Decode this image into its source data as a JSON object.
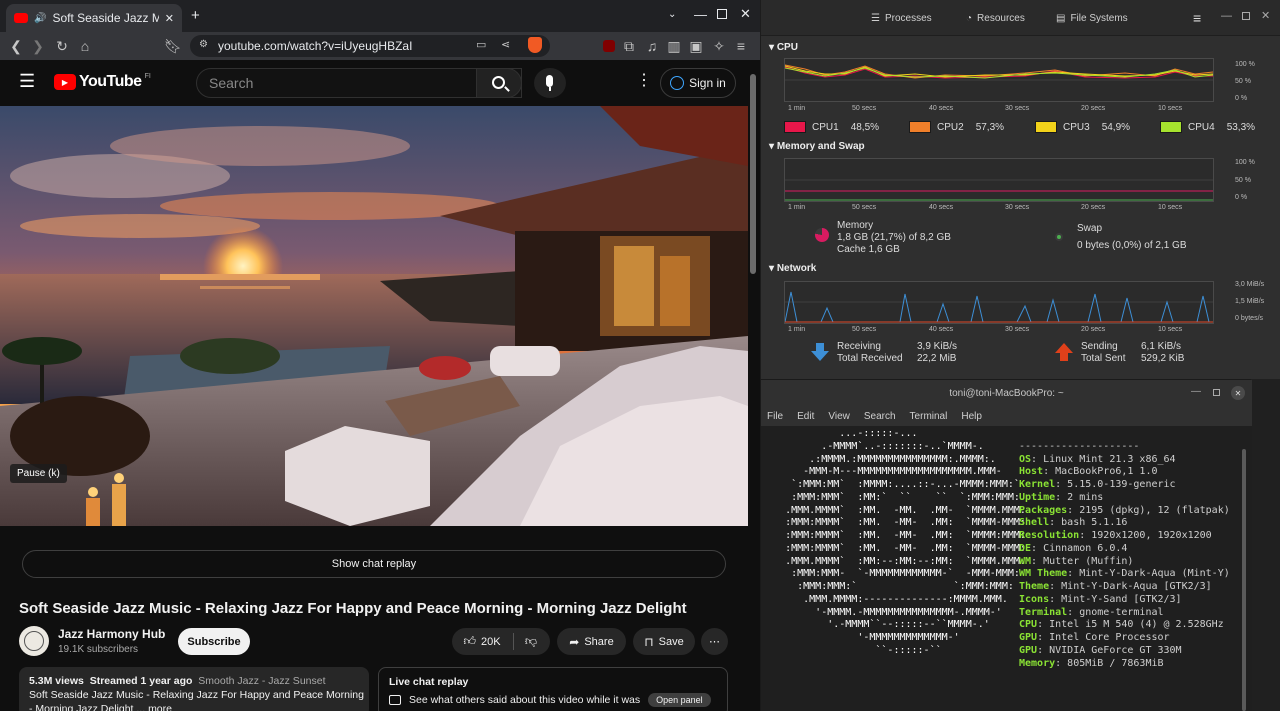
{
  "browser": {
    "tab_title": "Soft Seaside Jazz Music -",
    "url": "youtube.com/watch?v=iUyeugHBZaI"
  },
  "youtube": {
    "logo": "YouTube",
    "logo_region": "FI",
    "search_placeholder": "Search",
    "signin_label": "Sign in",
    "pause_tooltip": "Pause (k)",
    "chat_replay_button": "Show chat replay",
    "video_title": "Soft Seaside Jazz Music - Relaxing Jazz For Happy and Peace Morning - Morning Jazz Delight",
    "channel_name": "Jazz Harmony Hub",
    "subscribers": "19.1K subscribers",
    "subscribe_label": "Subscribe",
    "likes": "20K",
    "share_label": "Share",
    "save_label": "Save",
    "description": {
      "views": "5.3M views",
      "streamed": "Streamed 1 year ago",
      "tags": "Smooth Jazz - Jazz Sunset",
      "text": "Soft Seaside Jazz Music - Relaxing Jazz For Happy and Peace Morning",
      "more_prefix": "- Morning Jazz Delight ...",
      "more_label": "more"
    },
    "live_chat": {
      "title": "Live chat replay",
      "text": "See what others said about this video while it was",
      "button": "Open panel"
    }
  },
  "sysmon": {
    "tabs": [
      "Processes",
      "Resources",
      "File Systems"
    ],
    "cpu": {
      "title": "CPU",
      "ticks_x": [
        "1 min",
        "50 secs",
        "40 secs",
        "30 secs",
        "20 secs",
        "10 secs"
      ],
      "ticks_y": [
        "100 %",
        "50 %",
        "0 %"
      ],
      "legend": [
        {
          "name": "CPU1",
          "value": "48,5%",
          "color": "#e8174a"
        },
        {
          "name": "CPU2",
          "value": "57,3%",
          "color": "#f07f2a"
        },
        {
          "name": "CPU3",
          "value": "54,9%",
          "color": "#f2d21a"
        },
        {
          "name": "CPU4",
          "value": "53,3%",
          "color": "#a6e22e"
        }
      ]
    },
    "memory": {
      "title": "Memory and Swap",
      "mem_label": "Memory",
      "mem_value": "1,8 GB (21,7%) of 8,2 GB",
      "cache": "Cache 1,6 GB",
      "swap_label": "Swap",
      "swap_value": "0 bytes (0,0%) of 2,1 GB",
      "mem_color": "#d81b60",
      "swap_color": "#4caf50"
    },
    "network": {
      "title": "Network",
      "ticks_y": [
        "3,0 MiB/s",
        "1,5 MiB/s",
        "0 bytes/s"
      ],
      "receiving_label": "Receiving",
      "receiving_value": "3,9 KiB/s",
      "total_received_label": "Total Received",
      "total_received_value": "22,2 MiB",
      "sending_label": "Sending",
      "sending_value": "6,1 KiB/s",
      "total_sent_label": "Total Sent",
      "total_sent_value": "529,2 KiB"
    }
  },
  "terminal": {
    "title": "toni@toni-MacBookPro: ~",
    "menu": [
      "File",
      "Edit",
      "View",
      "Search",
      "Terminal",
      "Help"
    ],
    "separator": "--------------------",
    "info": [
      {
        "k": "OS",
        "v": "Linux Mint 21.3 x86_64"
      },
      {
        "k": "Host",
        "v": "MacBookPro6,1 1.0"
      },
      {
        "k": "Kernel",
        "v": "5.15.0-139-generic"
      },
      {
        "k": "Uptime",
        "v": "2 mins"
      },
      {
        "k": "Packages",
        "v": "2195 (dpkg), 12 (flatpak)"
      },
      {
        "k": "Shell",
        "v": "bash 5.1.16"
      },
      {
        "k": "Resolution",
        "v": "1920x1200, 1920x1200"
      },
      {
        "k": "DE",
        "v": "Cinnamon 6.0.4"
      },
      {
        "k": "WM",
        "v": "Mutter (Muffin)"
      },
      {
        "k": "WM Theme",
        "v": "Mint-Y-Dark-Aqua (Mint-Y)"
      },
      {
        "k": "Theme",
        "v": "Mint-Y-Dark-Aqua [GTK2/3]"
      },
      {
        "k": "Icons",
        "v": "Mint-Y-Sand [GTK2/3]"
      },
      {
        "k": "Terminal",
        "v": "gnome-terminal"
      },
      {
        "k": "CPU",
        "v": "Intel i5 M 540 (4) @ 2.528GHz"
      },
      {
        "k": "GPU",
        "v": "Intel Core Processor"
      },
      {
        "k": "GPU",
        "v": "NVIDIA GeForce GT 330M"
      },
      {
        "k": "Memory",
        "v": "805MiB / 7863MiB"
      }
    ],
    "palette": [
      "#2e2e2e",
      "#cc0000",
      "#4e9a06",
      "#c4a000",
      "#3465a4",
      "#75507b",
      "#06989a",
      "#d3d7cf",
      "#555753",
      "#ef2929",
      "#8ae234",
      "#fce94f",
      "#729fcf",
      "#ad7fa8",
      "#34e2e2",
      "#eeeeec"
    ]
  }
}
